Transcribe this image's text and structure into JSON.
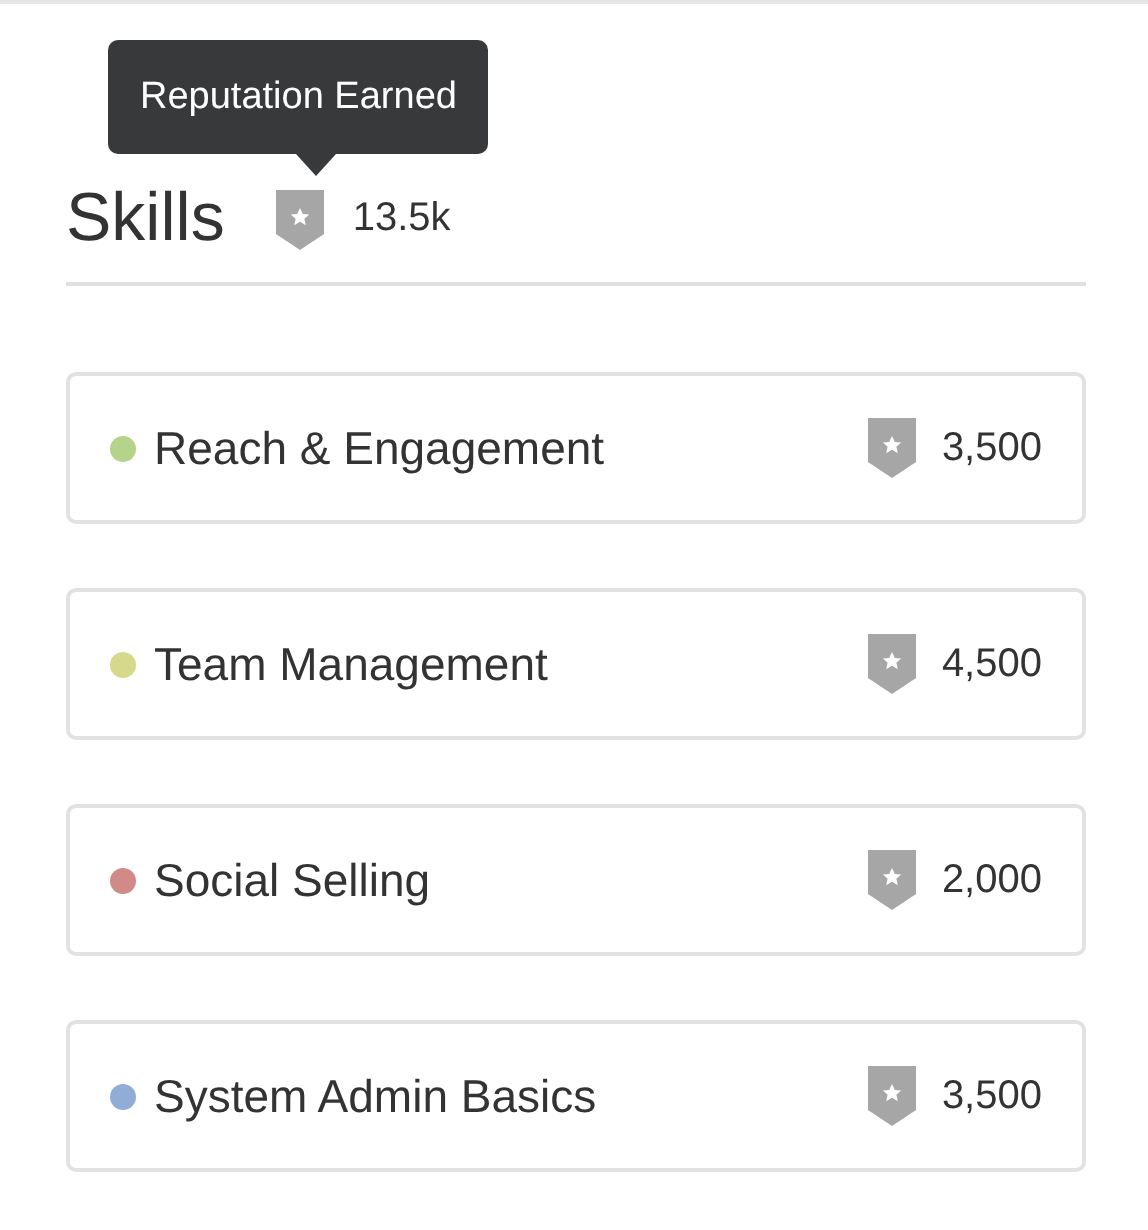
{
  "tooltip": {
    "text": "Reputation Earned"
  },
  "header": {
    "title": "Skills",
    "reputation": "13.5k"
  },
  "skills": [
    {
      "name": "Reach & Engagement",
      "color": "#b5d38a",
      "points": "3,500"
    },
    {
      "name": "Team Management",
      "color": "#d6d98c",
      "points": "4,500"
    },
    {
      "name": "Social Selling",
      "color": "#d08a88",
      "points": "2,000"
    },
    {
      "name": "System Admin Basics",
      "color": "#92acd8",
      "points": "3,500"
    }
  ]
}
